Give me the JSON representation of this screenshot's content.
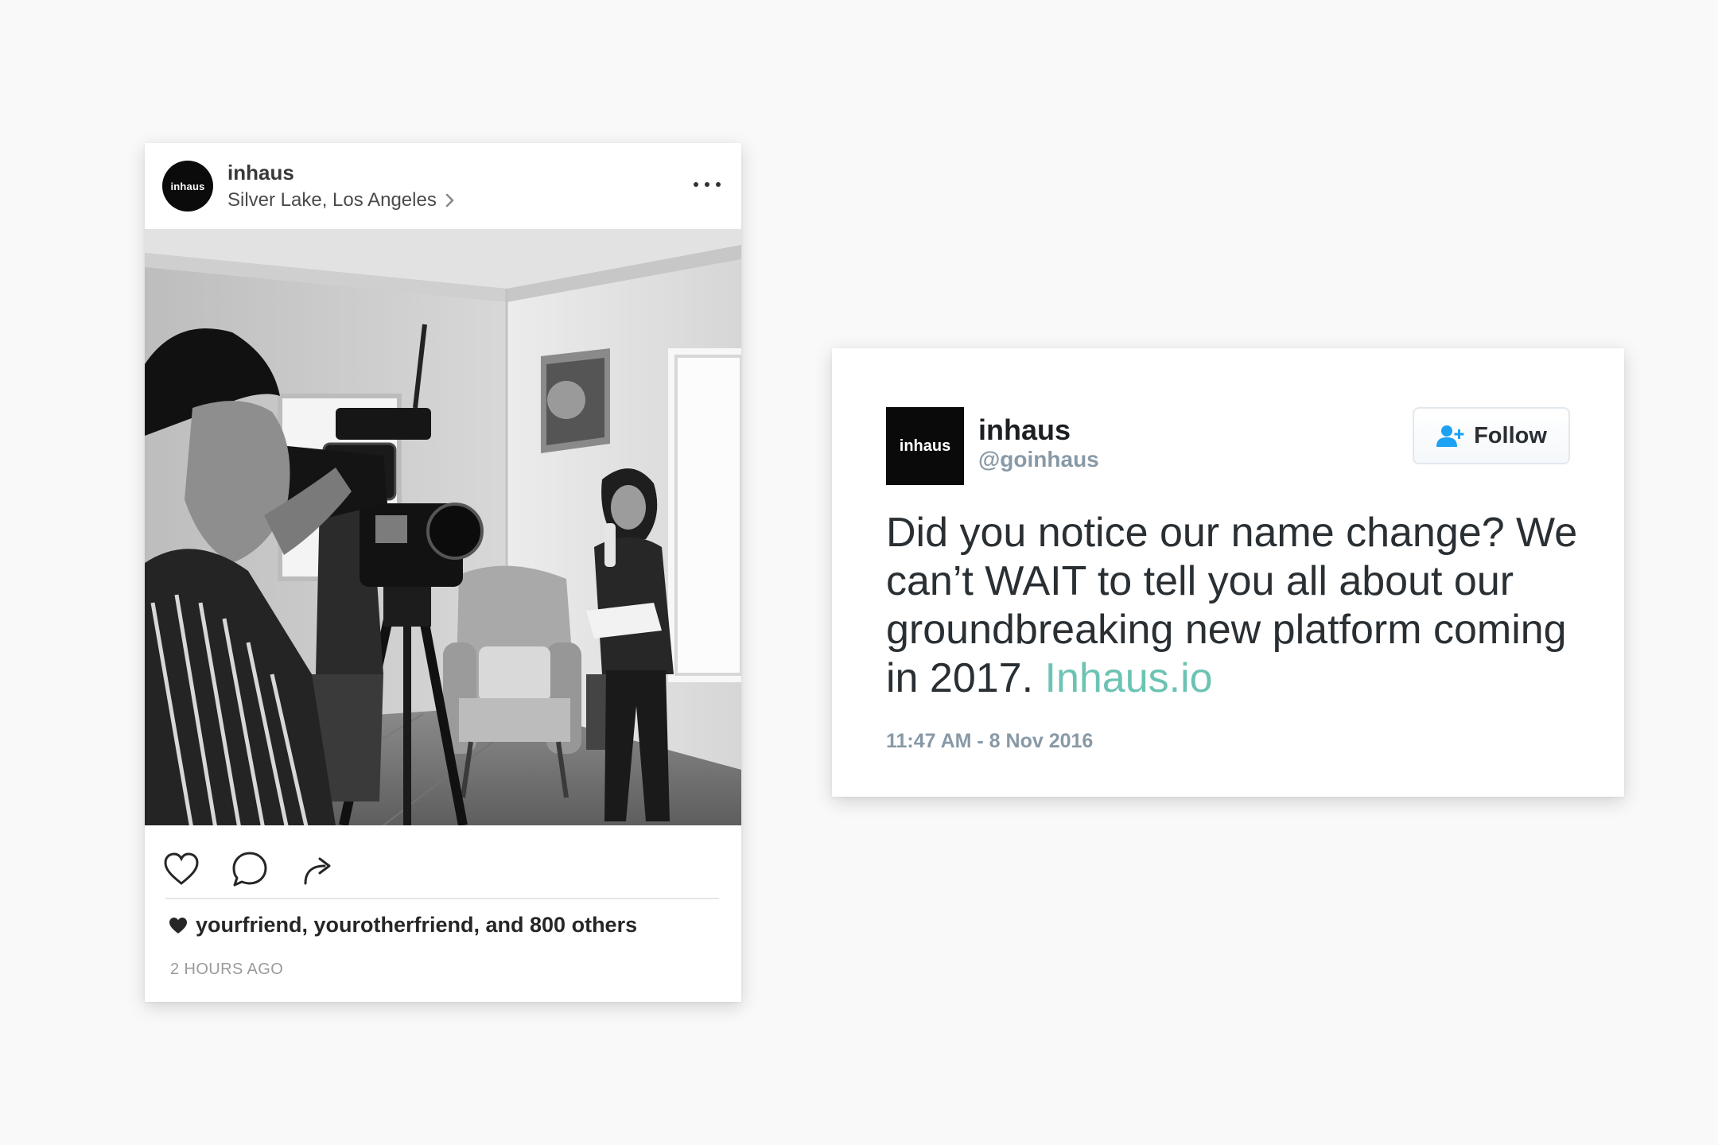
{
  "instagram_post": {
    "avatar_text": "inhaus",
    "username": "inhaus",
    "location": "Silver Lake, Los Angeles",
    "likes_text": "yourfriend, yourotherfriend, and 800 others",
    "time_ago": "2 HOURS AGO",
    "icons": [
      "more-options-icon",
      "chevron-right-icon",
      "heart-icon",
      "comment-icon",
      "share-icon",
      "heart-filled-icon"
    ],
    "photo_alt": "Black and white photo of a camera operator filming a woman reading from paper in a living room"
  },
  "tweet": {
    "avatar_text": "inhaus",
    "display_name": "inhaus",
    "handle": "@goinhaus",
    "follow_label": "Follow",
    "text": "Did you notice our name change? We can’t WAIT to tell you all about our groundbreaking new platform coming in 2017. ",
    "link_text": "Inhaus.io",
    "timestamp": "11:47 AM - 8 Nov 2016",
    "colors": {
      "link": "#6cc3b3",
      "follow_icon": "#1da1f2",
      "meta": "#8899a6"
    }
  }
}
